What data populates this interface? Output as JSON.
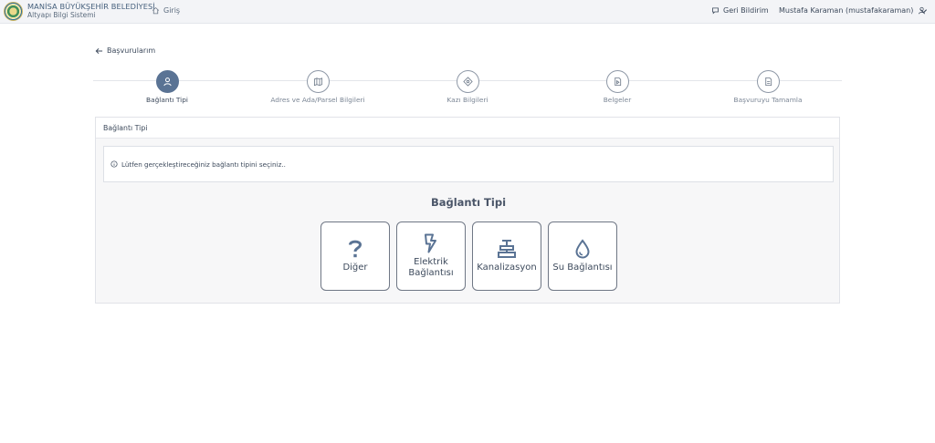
{
  "header": {
    "org_name": "MANİSA BÜYÜKŞEHİR BELEDİYESİ",
    "system_name": "Altyapı Bilgi Sistemi",
    "home_label": "Giriş",
    "feedback_label": "Geri Bildirim",
    "user_label": "Mustafa Karaman (mustafakaraman)"
  },
  "back_label": "Başvurularım",
  "steps": [
    {
      "label": "Bağlantı Tipi",
      "icon": "user-icon",
      "active": true
    },
    {
      "label": "Adres ve Ada/Parsel Bilgileri",
      "icon": "map-icon",
      "active": false
    },
    {
      "label": "Kazı Bilgileri",
      "icon": "compass-icon",
      "active": false
    },
    {
      "label": "Belgeler",
      "icon": "document-play-icon",
      "active": false
    },
    {
      "label": "Başvuruyu Tamamla",
      "icon": "document-icon",
      "active": false
    }
  ],
  "panel": {
    "title": "Bağlantı Tipi",
    "info_text": "Lütfen gerçekleştireceğiniz bağlantı tipini seçiniz..",
    "section_title": "Bağlantı Tipi"
  },
  "options": [
    {
      "line1": "Diğer",
      "line2": "",
      "icon": "question-icon"
    },
    {
      "line1": "Elektrik",
      "line2": "Bağlantısı",
      "icon": "lightning-icon"
    },
    {
      "line1": "Kanalizasyon",
      "line2": "",
      "icon": "pipe-icon"
    },
    {
      "line1": "Su Bağlantısı",
      "line2": "",
      "icon": "water-drop-icon"
    }
  ],
  "colors": {
    "accent": "#5a7394",
    "text": "#3d4a5c",
    "topbar": "#f3f4f7"
  }
}
